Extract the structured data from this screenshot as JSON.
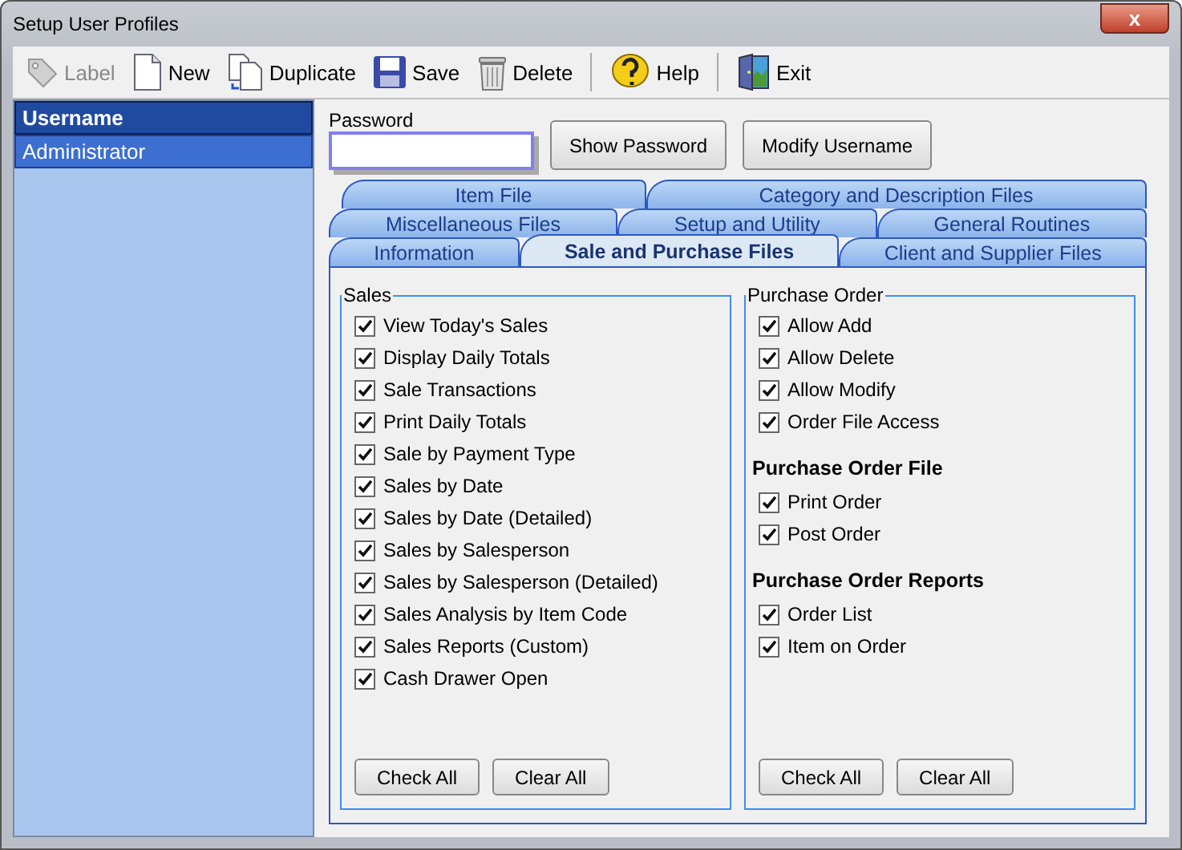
{
  "window": {
    "title": "Setup User Profiles",
    "close": "x"
  },
  "toolbar": [
    {
      "kind": "label",
      "label": "Label",
      "disabled": true
    },
    {
      "kind": "new",
      "label": "New",
      "disabled": false
    },
    {
      "kind": "duplicate",
      "label": "Duplicate",
      "disabled": false
    },
    {
      "kind": "save",
      "label": "Save",
      "disabled": false
    },
    {
      "kind": "delete",
      "label": "Delete",
      "disabled": false
    },
    {
      "kind": "separator"
    },
    {
      "kind": "help",
      "label": "Help",
      "disabled": false
    },
    {
      "kind": "separator"
    },
    {
      "kind": "exit",
      "label": "Exit",
      "disabled": false
    }
  ],
  "user_list": {
    "header": "Username",
    "items": [
      {
        "label": "Administrator",
        "selected": true
      }
    ]
  },
  "password": {
    "label": "Password"
  },
  "buttons": [
    "Show Password",
    "Modify Username"
  ],
  "tab_rows": [
    [
      {
        "label": "Item File",
        "selected": false
      },
      {
        "label": "Category and Description Files",
        "selected": false
      }
    ],
    [
      {
        "label": "Miscellaneous Files",
        "selected": false
      },
      {
        "label": "Setup and Utility",
        "selected": false
      },
      {
        "label": "General Routines",
        "selected": false
      }
    ],
    [
      {
        "label": "Information",
        "selected": false
      },
      {
        "label": "Sale and Purchase Files",
        "selected": true
      },
      {
        "label": "Client and Supplier Files",
        "selected": false
      }
    ]
  ],
  "sales": {
    "title": "Sales",
    "items": [
      {
        "label": "View Today's Sales",
        "checked": true
      },
      {
        "label": "Display Daily Totals",
        "checked": true
      },
      {
        "label": "Sale Transactions",
        "checked": true
      },
      {
        "label": "Print Daily Totals",
        "checked": true
      },
      {
        "label": "Sale by Payment Type",
        "checked": true
      },
      {
        "label": "Sales by Date",
        "checked": true
      },
      {
        "label": "Sales by Date (Detailed)",
        "checked": true
      },
      {
        "label": "Sales by Salesperson",
        "checked": true
      },
      {
        "label": "Sales by Salesperson (Detailed)",
        "checked": true
      },
      {
        "label": "Sales Analysis by Item Code",
        "checked": true
      },
      {
        "label": "Sales Reports (Custom)",
        "checked": true
      },
      {
        "label": "Cash Drawer Open",
        "checked": true
      }
    ],
    "buttons": [
      "Check All",
      "Clear All"
    ]
  },
  "purchase_order": {
    "title": "Purchase Order",
    "sections": [
      {
        "items": [
          {
            "label": "Allow Add",
            "checked": true
          },
          {
            "label": "Allow Delete",
            "checked": true
          },
          {
            "label": "Allow Modify",
            "checked": true
          },
          {
            "label": "Order File Access",
            "checked": true
          }
        ]
      },
      {
        "heading": "Purchase Order File",
        "items": [
          {
            "label": "Print Order",
            "checked": true
          },
          {
            "label": "Post Order",
            "checked": true
          }
        ]
      },
      {
        "heading": "Purchase Order Reports",
        "items": [
          {
            "label": "Order List",
            "checked": true
          },
          {
            "label": "Item on Order",
            "checked": true
          }
        ]
      }
    ],
    "buttons": [
      "Check All",
      "Clear All"
    ]
  }
}
